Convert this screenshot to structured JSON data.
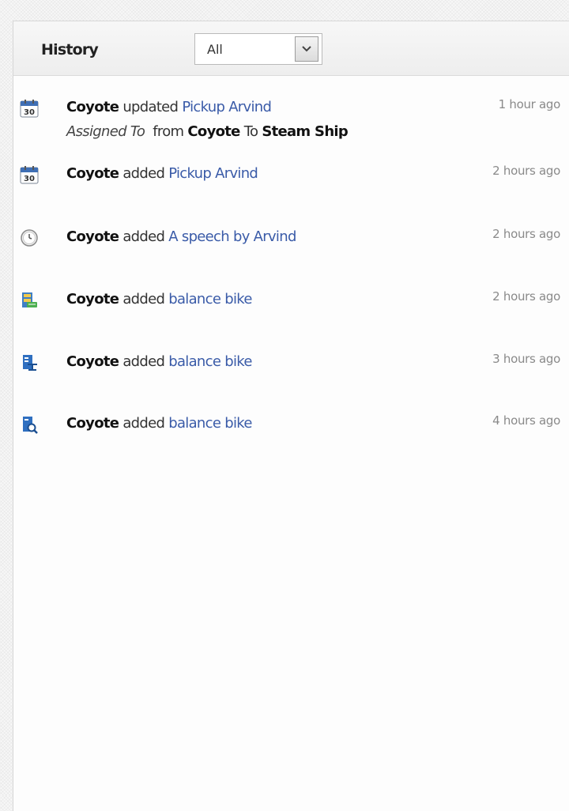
{
  "history": {
    "title": "History",
    "filter": {
      "value": "All"
    },
    "entries": [
      {
        "icon": "calendar-icon",
        "actor": "Coyote",
        "action": "updated",
        "target": "Pickup Arvind",
        "time": "1 hour ago",
        "detail": {
          "field": "Assigned To",
          "from_word": "from",
          "from_value": "Coyote",
          "to_word": "To",
          "to_value": "Steam Ship"
        }
      },
      {
        "icon": "calendar-icon",
        "actor": "Coyote",
        "action": "added",
        "target": "Pickup Arvind",
        "time": "2 hours ago"
      },
      {
        "icon": "clock-icon",
        "actor": "Coyote",
        "action": "added",
        "target": "A speech by Arvind",
        "time": "2 hours ago"
      },
      {
        "icon": "archive-box-icon",
        "actor": "Coyote",
        "action": "added",
        "target": "balance bike",
        "time": "2 hours ago"
      },
      {
        "icon": "document-tasks-icon",
        "actor": "Coyote",
        "action": "added",
        "target": "balance bike",
        "time": "3 hours ago"
      },
      {
        "icon": "document-search-icon",
        "actor": "Coyote",
        "action": "added",
        "target": "balance bike",
        "time": "4 hours ago"
      }
    ]
  }
}
